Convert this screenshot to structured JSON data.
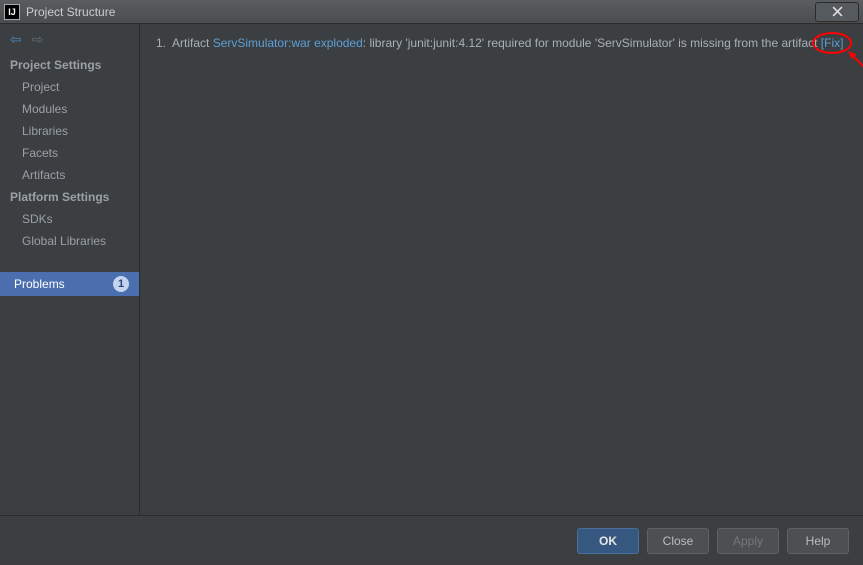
{
  "window": {
    "title": "Project Structure",
    "close_icon": "x"
  },
  "sidebar": {
    "section1": "Project Settings",
    "section2": "Platform Settings",
    "items1": [
      "Project",
      "Modules",
      "Libraries",
      "Facets",
      "Artifacts"
    ],
    "items2": [
      "SDKs",
      "Global Libraries"
    ],
    "problems_label": "Problems",
    "problems_count": "1"
  },
  "problem": {
    "index": "1.",
    "prefix": "Artifact ",
    "artifact_link": "ServSimulator:war exploded",
    "mid": ": library 'junit:junit:4.12' required for module 'ServSimulator' is missing from the artifact ",
    "fix_link": "[Fix]"
  },
  "buttons": {
    "ok": "OK",
    "close": "Close",
    "apply": "Apply",
    "help": "Help"
  }
}
